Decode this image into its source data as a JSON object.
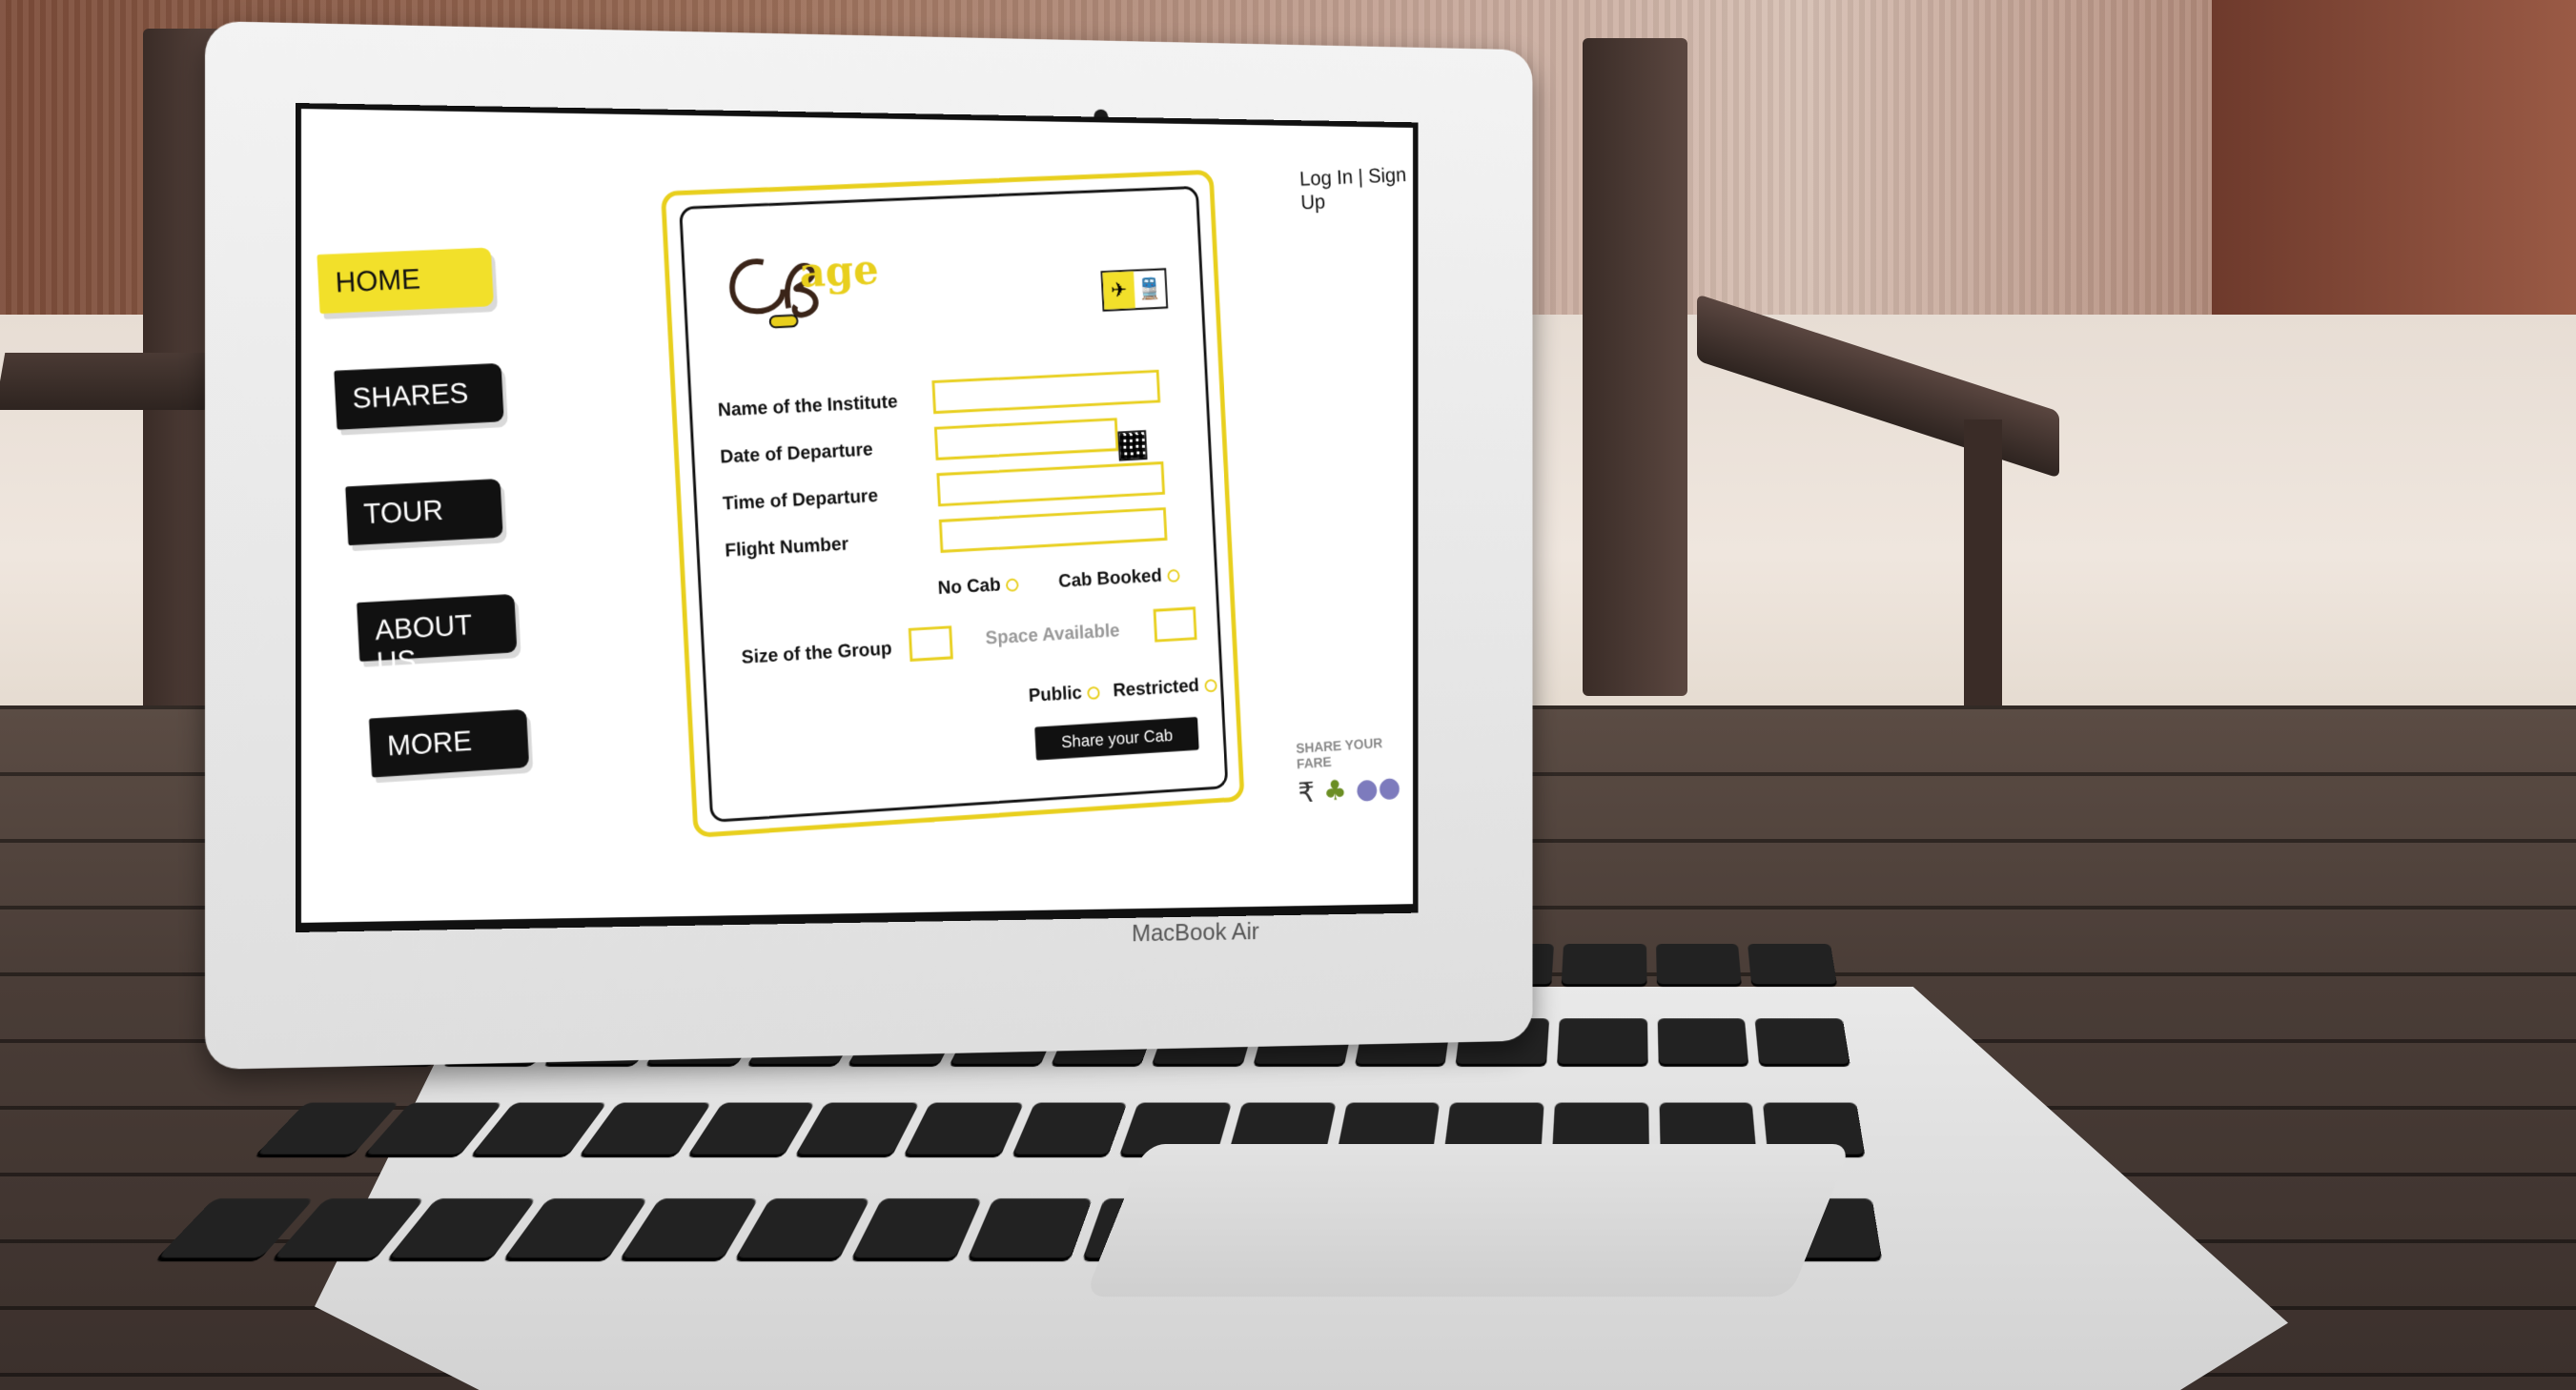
{
  "nav": {
    "items": [
      {
        "label": "HOME"
      },
      {
        "label": "SHARES"
      },
      {
        "label": "TOUR"
      },
      {
        "label": "ABOUT US"
      },
      {
        "label": "MORE"
      }
    ]
  },
  "auth": {
    "login": "Log In",
    "separator": "|",
    "signup": "Sign Up"
  },
  "brand": {
    "word": "age"
  },
  "form": {
    "institute_label": "Name of the Institute",
    "departure_date_label": "Date of Departure",
    "departure_time_label": "Time of Departure",
    "flight_label": "Flight Number",
    "no_cab_label": "No Cab",
    "cab_booked_label": "Cab Booked",
    "group_size_label": "Size of the Group",
    "space_available_label": "Space Available",
    "public_label": "Public",
    "restricted_label": "Restricted",
    "submit_label": "Share your Cab"
  },
  "badge": {
    "title": "SHARE YOUR FARE"
  },
  "device": {
    "label": "MacBook Air"
  },
  "colors": {
    "accent": "#e8cf1d",
    "dark": "#111111"
  }
}
